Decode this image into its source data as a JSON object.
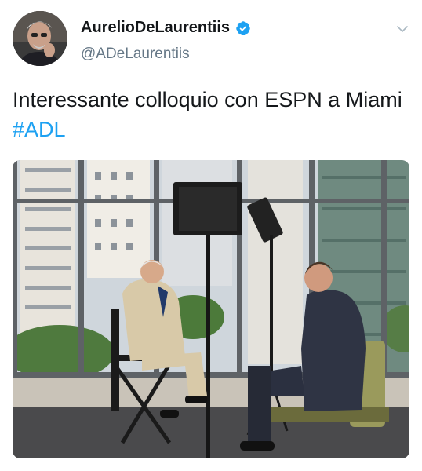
{
  "tweet": {
    "author": {
      "display_name": "AurelioDeLaurentiis",
      "handle": "@ADeLaurentiis",
      "verified": true,
      "avatar": "profile-photo-man-with-glasses"
    },
    "text_before": "Interessante colloquio con ESPN a Miami ",
    "hashtag": "#ADL",
    "menu_icon": "chevron-down-icon",
    "media": {
      "kind": "photo",
      "subject": "Two men seated in an interview setup by tall windows overlooking city buildings, with a studio light and a camera"
    }
  },
  "colors": {
    "text": "#14171a",
    "secondary_text": "#657786",
    "link": "#1da1f2",
    "verified_badge": "#1da1f2"
  }
}
